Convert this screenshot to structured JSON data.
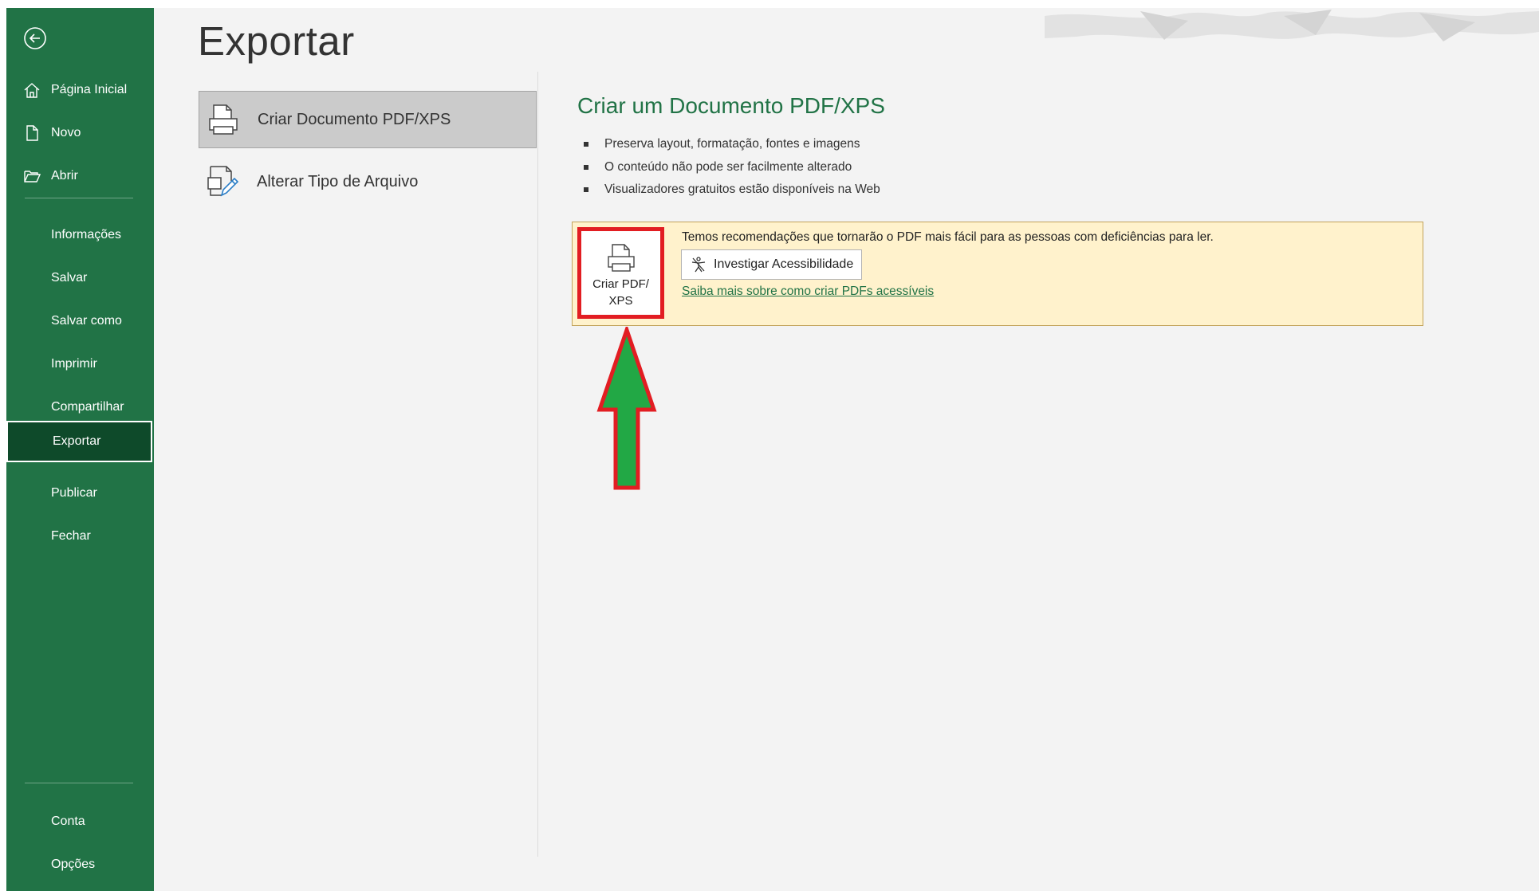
{
  "sidebar": {
    "back_icon": "back-arrow-circle-icon",
    "top_items": [
      {
        "label": "Página Inicial",
        "icon": "home-icon"
      },
      {
        "label": "Novo",
        "icon": "new-document-icon"
      },
      {
        "label": "Abrir",
        "icon": "open-folder-icon"
      }
    ],
    "items": [
      {
        "label": "Informações"
      },
      {
        "label": "Salvar"
      },
      {
        "label": "Salvar como"
      },
      {
        "label": "Imprimir"
      },
      {
        "label": "Compartilhar"
      },
      {
        "label": "Exportar",
        "active": true
      },
      {
        "label": "Publicar"
      },
      {
        "label": "Fechar"
      }
    ],
    "bottom_items": [
      {
        "label": "Conta"
      },
      {
        "label": "Opções"
      }
    ]
  },
  "main": {
    "title": "Exportar",
    "export_options": [
      {
        "label": "Criar Documento PDF/XPS",
        "icon": "pdf-document-icon",
        "selected": true
      },
      {
        "label": "Alterar Tipo de Arquivo",
        "icon": "change-file-type-icon",
        "selected": false
      }
    ],
    "detail": {
      "title": "Criar um Documento PDF/XPS",
      "bullets": [
        "Preserva layout, formatação, fontes e imagens",
        "O conteúdo não pode ser facilmente alterado",
        "Visualizadores gratuitos estão disponíveis na Web"
      ],
      "recommendation": {
        "text": "Temos recomendações que tornarão o PDF mais fácil para as pessoas com deficiências para ler.",
        "create_button_label": "Criar PDF/ XPS",
        "accessibility_button_label": "Investigar Acessibilidade",
        "link_text": "Saiba mais sobre como criar PDFs acessíveis"
      }
    }
  },
  "colors": {
    "sidebar_bg": "#217346",
    "sidebar_active_bg": "#0e4a2a",
    "accent": "#217346",
    "recommend_bg": "#fff2cc",
    "highlight_red": "#e21d22",
    "arrow_green": "#22a845"
  }
}
